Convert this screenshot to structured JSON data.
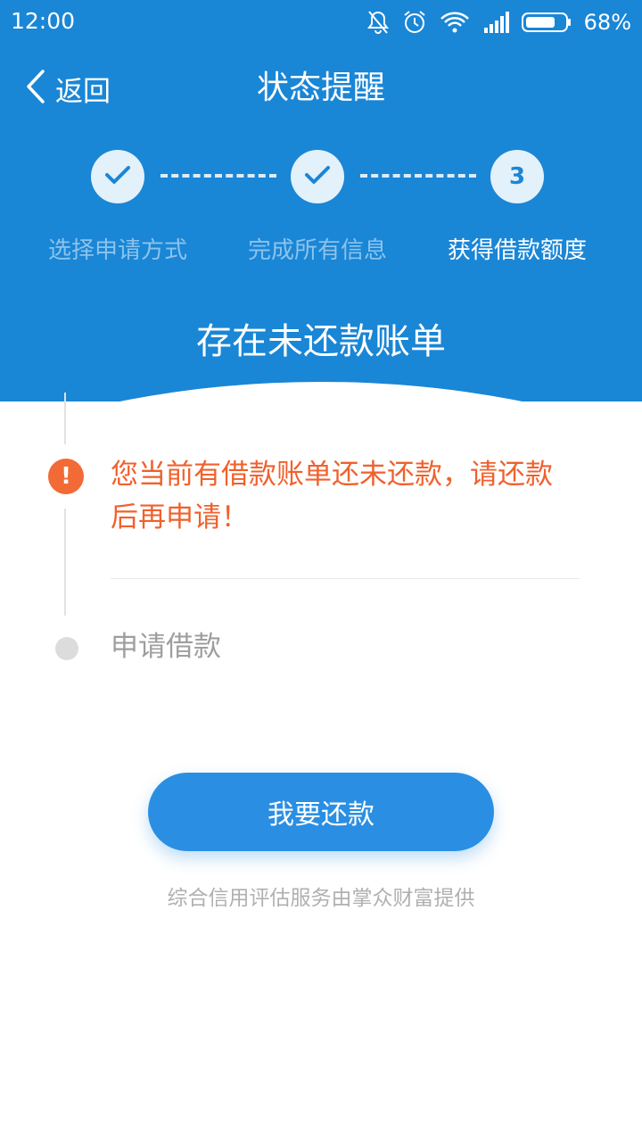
{
  "status_bar": {
    "time": "12:00",
    "battery_percent": "68%",
    "icons": [
      "bell-off-icon",
      "alarm-icon",
      "wifi-icon",
      "signal-icon",
      "battery-icon"
    ]
  },
  "nav": {
    "back_label": "返回",
    "title": "状态提醒"
  },
  "stepper": {
    "steps": [
      {
        "label": "选择申请方式",
        "state": "done"
      },
      {
        "label": "完成所有信息",
        "state": "done"
      },
      {
        "label": "获得借款额度",
        "state": "current",
        "number": "3"
      }
    ]
  },
  "hero": {
    "title": "存在未还款账单"
  },
  "timeline": {
    "alert_text": "您当前有借款账单还未还款，请还款后再申请！",
    "pending_label": "申请借款"
  },
  "actions": {
    "repay_label": "我要还款"
  },
  "footer": {
    "note": "综合信用评估服务由掌众财富提供"
  },
  "colors": {
    "header_blue": "#1a86d6",
    "alert_orange": "#f0612c",
    "button_blue": "#2a8fe3"
  }
}
